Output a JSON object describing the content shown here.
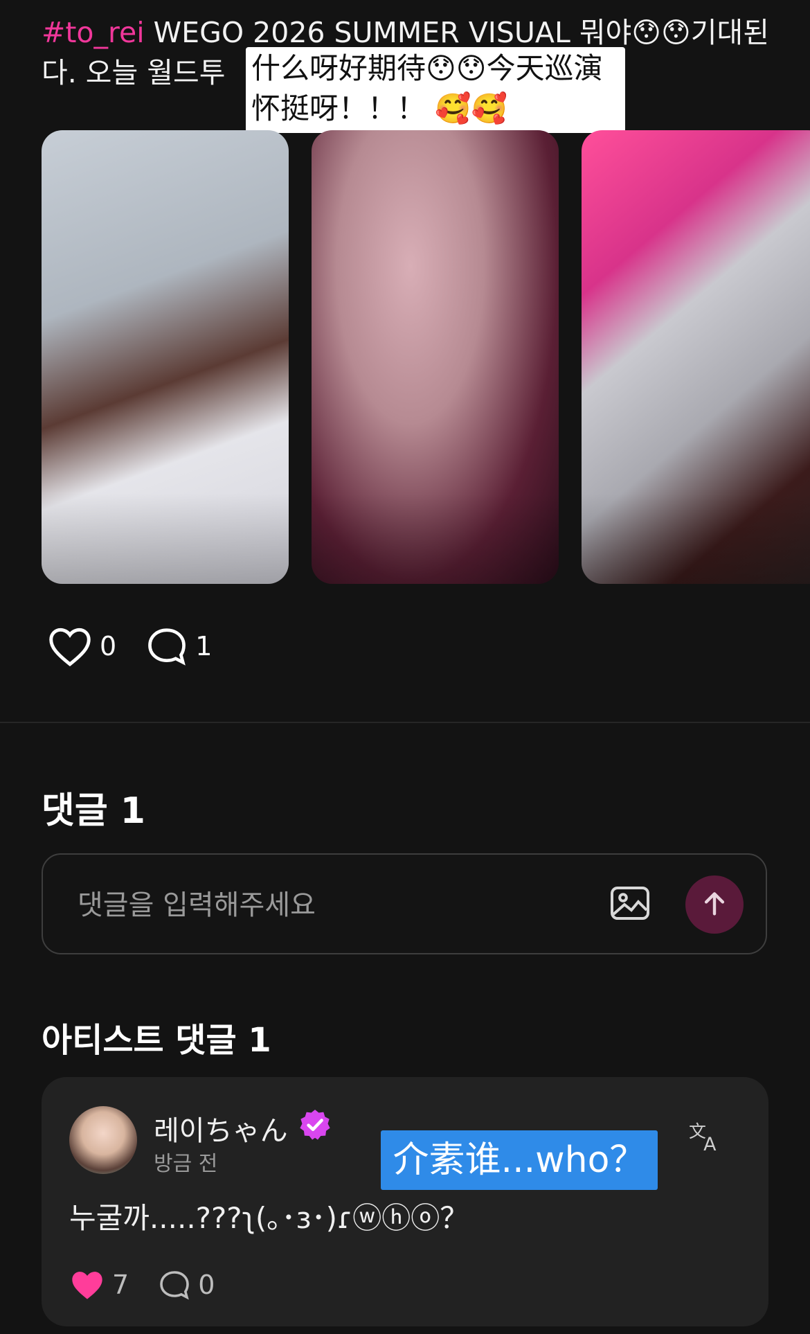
{
  "post": {
    "hashtag": "#to_rei",
    "caption_text": " WEGO 2026 SUMMER VISUAL 뭐야😯😯기대된다. 오늘 월드투",
    "translation_overlay": "什么呀好期待😯😯今天巡演怀挺呀！！！ 🥰🥰",
    "thumbnails": [
      "photo-1",
      "photo-2",
      "photo-3"
    ],
    "likes": "0",
    "comments": "1"
  },
  "comments_section": {
    "title": "댓글 1",
    "input_placeholder": "댓글을 입력해주세요"
  },
  "artist_comments": {
    "title": "아티스트 댓글 1",
    "comment": {
      "author": "레이ちゃん",
      "time": "방금 전",
      "text": "누굴까.....???ʅ(｡･ɜ･)ɾⓦⓗⓞ？",
      "translation_overlay": "介素谁...who？",
      "likes": "7",
      "replies": "0"
    }
  },
  "colors": {
    "background": "#131313",
    "hashtag": "#f0379a",
    "send_button": "#5a1a3a",
    "liked_heart": "#ff3d9a",
    "verified_badge": "#d946ef",
    "translate_overlay": "#2f8be8"
  }
}
